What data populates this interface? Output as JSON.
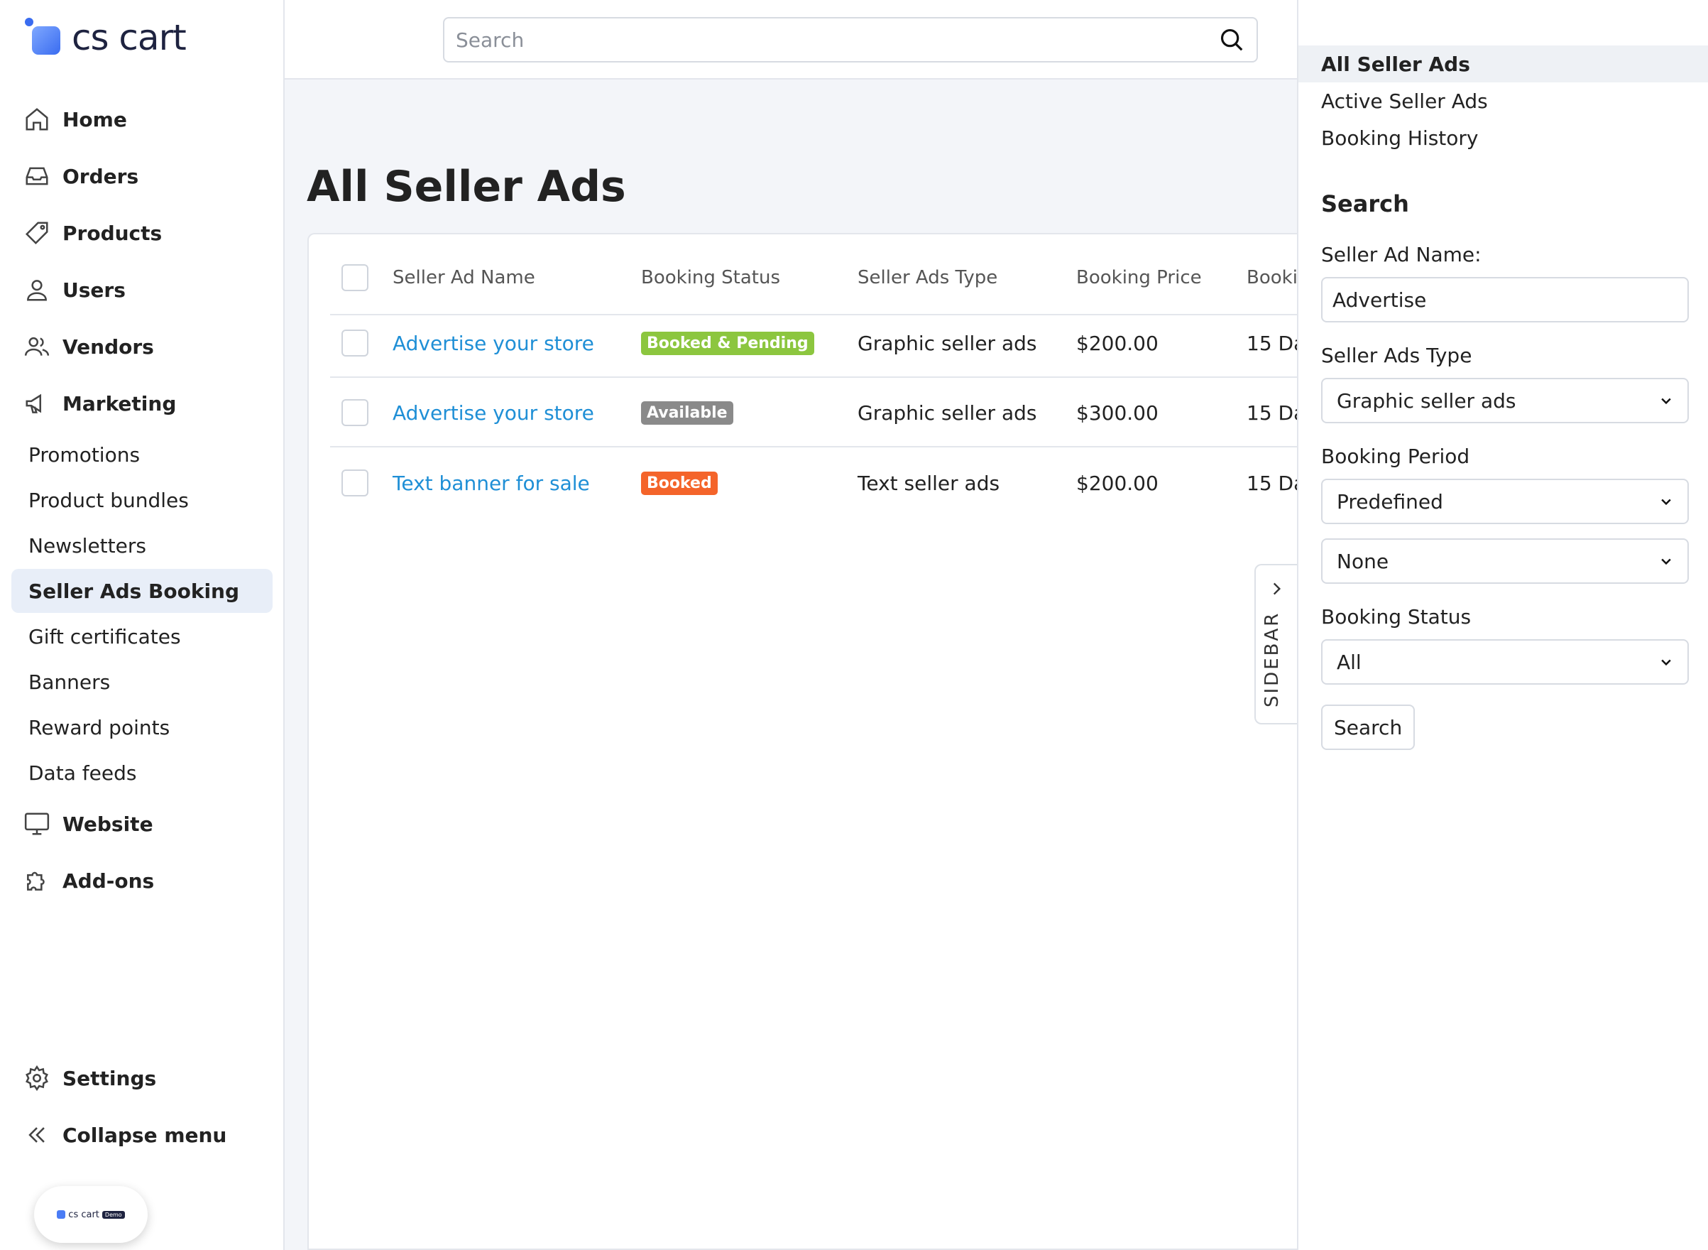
{
  "logo": {
    "text": "cs cart"
  },
  "nav": {
    "items": [
      {
        "label": "Home",
        "icon": "home-icon"
      },
      {
        "label": "Orders",
        "icon": "inbox-icon"
      },
      {
        "label": "Products",
        "icon": "tag-icon"
      },
      {
        "label": "Users",
        "icon": "user-icon"
      },
      {
        "label": "Vendors",
        "icon": "users-icon"
      },
      {
        "label": "Marketing",
        "icon": "megaphone-icon"
      }
    ],
    "marketing_sub": [
      {
        "label": "Promotions"
      },
      {
        "label": "Product bundles"
      },
      {
        "label": "Newsletters"
      },
      {
        "label": "Seller Ads Booking",
        "active": true
      },
      {
        "label": "Gift certificates"
      },
      {
        "label": "Banners"
      },
      {
        "label": "Reward points"
      },
      {
        "label": "Data feeds"
      }
    ],
    "bottom_items": [
      {
        "label": "Website",
        "icon": "monitor-icon"
      },
      {
        "label": "Add-ons",
        "icon": "puzzle-icon"
      }
    ],
    "settings": "Settings",
    "collapse": "Collapse menu"
  },
  "demo_badge": {
    "logo_text": "cs cart",
    "tag": "Demo"
  },
  "topbar": {
    "search_placeholder": "Search"
  },
  "page": {
    "title": "All Seller Ads"
  },
  "table": {
    "headers": [
      "Seller Ad Name",
      "Booking Status",
      "Seller Ads Type",
      "Booking Price",
      "Booki"
    ],
    "rows": [
      {
        "name": "Advertise your store",
        "status": "Booked & Pending",
        "status_color": "#8cc63f",
        "type": "Graphic seller ads",
        "price": "$200.00",
        "period": "15 Da"
      },
      {
        "name": "Advertise your store",
        "status": "Available",
        "status_color": "#8a8a8a",
        "type": "Graphic seller ads",
        "price": "$300.00",
        "period": "15 Da"
      },
      {
        "name": "Text banner for sale",
        "status": "Booked",
        "status_color": "#f4642a",
        "type": "Text seller ads",
        "price": "$200.00",
        "period": "15 Da"
      }
    ]
  },
  "sidebar_toggle": {
    "label": "SIDEBAR"
  },
  "right_panel": {
    "nav": [
      {
        "label": "All Seller Ads",
        "active": true
      },
      {
        "label": "Active Seller Ads"
      },
      {
        "label": "Booking History"
      }
    ],
    "search_heading": "Search",
    "ad_name_label": "Seller Ad Name:",
    "ad_name_value": "Advertise",
    "ads_type_label": "Seller Ads Type",
    "ads_type_value": "Graphic seller ads",
    "period_label": "Booking Period",
    "period_value": "Predefined",
    "period_range_value": "None",
    "status_label": "Booking Status",
    "status_value": "All",
    "search_button": "Search"
  },
  "colors": {
    "link": "#1f8fd6",
    "active_bg": "#e8eef8",
    "brand": "#3a6cf0"
  }
}
